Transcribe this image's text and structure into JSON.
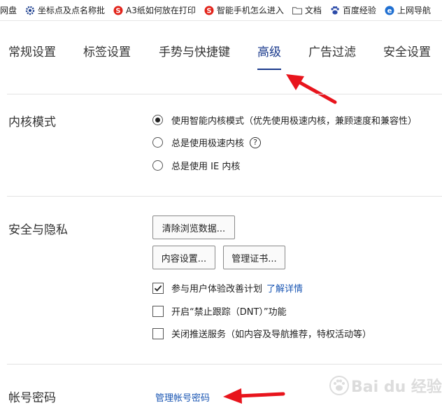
{
  "bookmarks": [
    {
      "label": "网盘",
      "icon": "none"
    },
    {
      "label": "坐标点及点名称批",
      "icon": "gear-icon"
    },
    {
      "label": "A3纸如何放在打印",
      "icon": "sogou-icon"
    },
    {
      "label": "智能手机怎么进入",
      "icon": "sogou-icon"
    },
    {
      "label": "文档",
      "icon": "folder-icon"
    },
    {
      "label": "百度经验",
      "icon": "baidu-paw-icon"
    },
    {
      "label": "上网导航",
      "icon": "ie-icon"
    }
  ],
  "tabs": [
    {
      "label": "常规设置"
    },
    {
      "label": "标签设置"
    },
    {
      "label": "手势与快捷键"
    },
    {
      "label": "高级"
    },
    {
      "label": "广告过滤"
    },
    {
      "label": "安全设置"
    }
  ],
  "active_tab": "高级",
  "kernel": {
    "title": "内核模式",
    "options": [
      {
        "label": "使用智能内核模式（优先使用极速内核，兼顾速度和兼容性）",
        "checked": true
      },
      {
        "label": "总是使用极速内核",
        "checked": false,
        "help": "?"
      },
      {
        "label": "总是使用 IE 内核",
        "checked": false
      }
    ]
  },
  "privacy": {
    "title": "安全与隐私",
    "clear_button": "清除浏览数据...",
    "content_button": "内容设置...",
    "cert_button": "管理证书...",
    "checks": [
      {
        "label": "参与用户体验改善计划",
        "link": "了解详情",
        "checked": true
      },
      {
        "label": "开启“禁止跟踪（DNT）”功能",
        "checked": false
      },
      {
        "label": "关闭推送服务（如内容及导航推荐，特权活动等）",
        "checked": false
      }
    ]
  },
  "account": {
    "title": "帐号密码",
    "link": "管理帐号密码"
  },
  "watermark": {
    "text": "Bai du 经验"
  },
  "colors": {
    "accent": "#1a3a8c",
    "link": "#1a56b3",
    "arrow": "#e8141c"
  }
}
